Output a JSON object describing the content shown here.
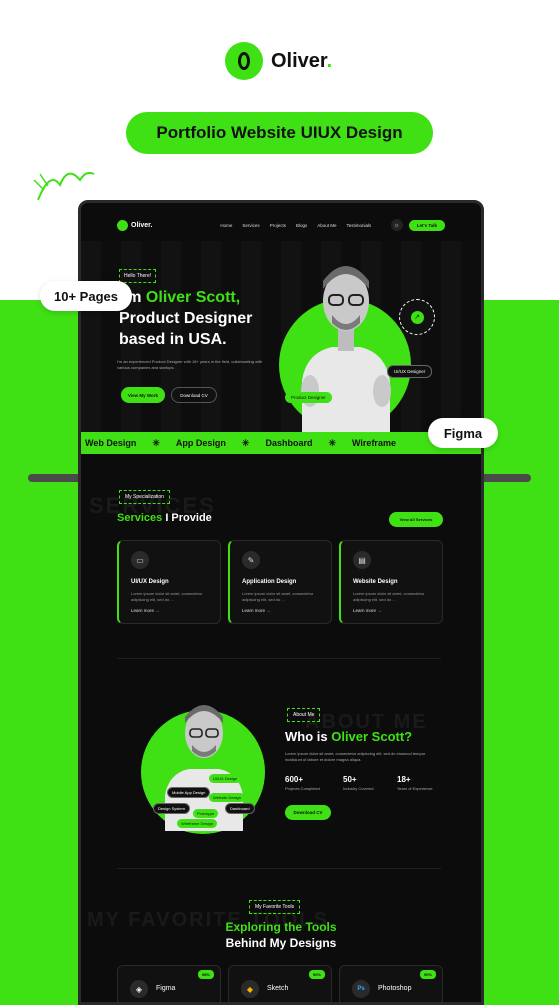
{
  "brand": {
    "name": "Oliver",
    "dot": "."
  },
  "banner": "Portfolio Website UIUX Design",
  "pills": {
    "pages": "10+ Pages",
    "figma": "Figma"
  },
  "nav": {
    "logo": "Oliver.",
    "menu": [
      "Home",
      "Services",
      "Projects",
      "Blogs",
      "About Me",
      "Testimonials"
    ],
    "theme_icon": "sun-icon",
    "cta": "Let's Talk"
  },
  "hero": {
    "hello": "Hello There!",
    "title_prefix": "I'm ",
    "title_name": "Oliver Scott,",
    "title_line2": "Product Designer",
    "title_line3": "based in USA.",
    "desc": "I'm an experienced Product Designer with 18+ years in the field, collaborating with various companies and startups.",
    "btn_work": "View My Work",
    "btn_cv": "Download CV",
    "tag_product": "Product Designer",
    "tag_uiux": "UI/UX Designer"
  },
  "ticker": [
    "Web Design",
    "App Design",
    "Dashboard",
    "Wireframe"
  ],
  "services": {
    "label": "My Specialization",
    "ghost": "SERVICES",
    "title_acc": "Services",
    "title_rest": " I Provide",
    "view_all": "View All Services",
    "cards": [
      {
        "icon": "monitor-icon",
        "title": "UI/UX Design",
        "desc": "Lorem ipsum dolor sit amet, consectetur adipiscing elit, sed do ...",
        "link": "Learn more"
      },
      {
        "icon": "vector-icon",
        "title": "Application Design",
        "desc": "Lorem ipsum dolor sit amet, consectetur adipiscing elit, sed do ...",
        "link": "Learn more"
      },
      {
        "icon": "website-icon",
        "title": "Website Design",
        "desc": "Lorem ipsum dolor sit amet, consectetur adipiscing elit, sed do ...",
        "link": "Learn more"
      }
    ]
  },
  "about": {
    "label": "About Me",
    "ghost": "ABOUT ME",
    "title_prefix": "Who is ",
    "title_name": "Oliver Scott?",
    "desc": "Lorem ipsum dolor sit amet, consectetur adipiscing elit, sed do eiusmod tempor incididunt ut labore et dolore magna aliqua.",
    "stats": [
      {
        "num": "600+",
        "cap": "Projects Completed"
      },
      {
        "num": "50+",
        "cap": "Industry Covered"
      },
      {
        "num": "18+",
        "cap": "Years of Experience"
      }
    ],
    "btn": "Download CV",
    "tags": [
      "UI/UX Design",
      "Mobile App Design",
      "Website Design",
      "Design System",
      "Prototype",
      "Dashboard",
      "Wireframe Design"
    ]
  },
  "tools": {
    "label": "My Favorite Tools",
    "ghost": "MY FAVORITE TOOLS",
    "title_acc": "Exploring the Tools",
    "title_line2": "Behind My Designs",
    "items": [
      {
        "icon": "figma-icon",
        "name": "Figma",
        "pct": "98%"
      },
      {
        "icon": "sketch-icon",
        "name": "Sketch",
        "pct": "90%"
      },
      {
        "icon": "photoshop-icon",
        "name": "Photoshop",
        "pct": "90%"
      }
    ]
  },
  "colors": {
    "accent": "#3fe115",
    "dark": "#0c0c0c"
  }
}
